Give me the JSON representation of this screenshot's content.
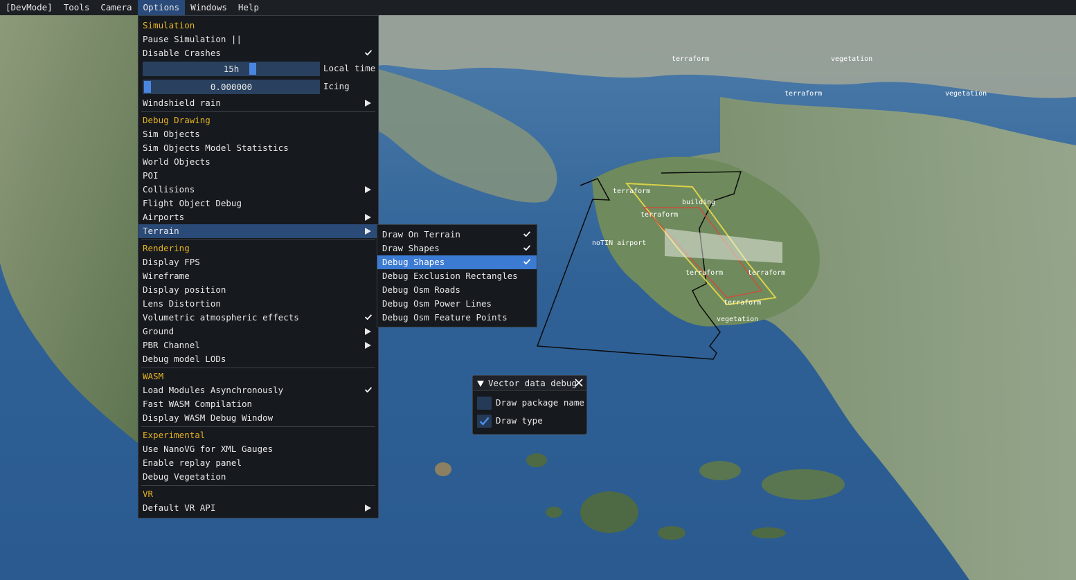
{
  "menubar": {
    "items": [
      {
        "label": "[DevMode]"
      },
      {
        "label": "Tools"
      },
      {
        "label": "Camera"
      },
      {
        "label": "Options"
      },
      {
        "label": "Windows"
      },
      {
        "label": "Help"
      }
    ]
  },
  "options_menu": {
    "simulation": {
      "header": "Simulation",
      "pause": "Pause Simulation ||",
      "disable_crashes": "Disable Crashes",
      "disable_crashes_checked": true,
      "local_time_value": "15h",
      "local_time_label": "Local time",
      "local_time_fraction": 0.63,
      "icing_value": "0.000000",
      "icing_label": "Icing",
      "icing_fraction": 0.0,
      "windshield_rain": "Windshield rain"
    },
    "debug_drawing": {
      "header": "Debug Drawing",
      "sim_objects": "Sim Objects",
      "sim_objects_model_statistics": "Sim Objects Model Statistics",
      "world_objects": "World Objects",
      "poi": "POI",
      "collisions": "Collisions",
      "flight_object_debug": "Flight Object Debug",
      "airports": "Airports",
      "terrain": "Terrain"
    },
    "rendering": {
      "header": "Rendering",
      "display_fps": "Display FPS",
      "wireframe": "Wireframe",
      "display_position": "Display position",
      "lens_distortion": "Lens Distortion",
      "volumetric": "Volumetric atmospheric effects",
      "volumetric_checked": true,
      "ground": "Ground",
      "pbr_channel": "PBR Channel",
      "debug_model_lods": "Debug model LODs"
    },
    "wasm": {
      "header": "WASM",
      "load_async": "Load Modules Asynchronously",
      "load_async_checked": true,
      "fast_compilation": "Fast WASM Compilation",
      "debug_window": "Display WASM Debug Window"
    },
    "experimental": {
      "header": "Experimental",
      "nanovg": "Use NanoVG for XML Gauges",
      "replay_panel": "Enable replay panel",
      "debug_vegetation": "Debug Vegetation"
    },
    "vr": {
      "header": "VR",
      "default_api": "Default VR API"
    }
  },
  "terrain_submenu": {
    "items": [
      {
        "label": "Draw On Terrain",
        "checked": true
      },
      {
        "label": "Draw Shapes",
        "checked": true
      },
      {
        "label": "Debug Shapes",
        "checked": true,
        "selected": true
      },
      {
        "label": "Debug Exclusion Rectangles",
        "checked": false
      },
      {
        "label": "Debug Osm Roads",
        "checked": false
      },
      {
        "label": "Debug Osm Power Lines",
        "checked": false
      },
      {
        "label": "Debug Osm Feature Points",
        "checked": false
      }
    ]
  },
  "vector_window": {
    "title": "Vector data debug",
    "options": [
      {
        "label": "Draw package name",
        "checked": false
      },
      {
        "label": "Draw type",
        "checked": true
      }
    ]
  },
  "scene_labels": {
    "terraform": "terraform",
    "vegetation": "vegetation",
    "building": "building",
    "notin_airport": "noTIN airport"
  },
  "colors": {
    "menubar_bg": "#1c1f24",
    "menu_bg": "#16191d",
    "section_header": "#e6b422",
    "highlight": "#2a4a78",
    "selected": "#3c7bd4",
    "slider_bg": "#29415f",
    "slider_grab": "#4a86e0"
  }
}
